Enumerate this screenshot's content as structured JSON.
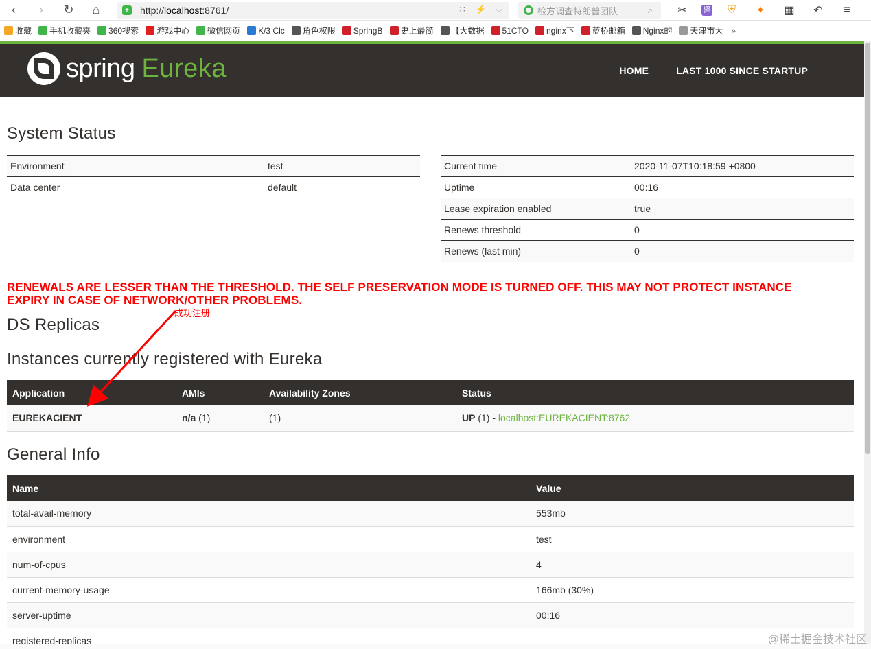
{
  "browser": {
    "url_prefix": "http://",
    "url_host": "localhost",
    "url_rest": ":8761/",
    "search_placeholder": "检方调查特朗普团队",
    "bookmarks": [
      {
        "label": "收藏",
        "color": "#f5a623"
      },
      {
        "label": "手机收藏夹",
        "color": "#3fb54a"
      },
      {
        "label": "360搜索",
        "color": "#3fb54a"
      },
      {
        "label": "游戏中心",
        "color": "#e02020"
      },
      {
        "label": "微信网页",
        "color": "#3fb54a"
      },
      {
        "label": "K/3 Clc",
        "color": "#2a7ad2"
      },
      {
        "label": "角色权限",
        "color": "#555555"
      },
      {
        "label": "SpringB",
        "color": "#d0202a"
      },
      {
        "label": "史上最简",
        "color": "#d0202a"
      },
      {
        "label": "【大数据",
        "color": "#555555"
      },
      {
        "label": "51CTO",
        "color": "#d0202a"
      },
      {
        "label": "nginx下",
        "color": "#d0202a"
      },
      {
        "label": "蓝桥邮箱",
        "color": "#d0202a"
      },
      {
        "label": "Nginx的",
        "color": "#555555"
      },
      {
        "label": "天津市大",
        "color": "#999999"
      }
    ],
    "bookmarks_more": "»"
  },
  "navbar": {
    "brand_spring": "spring",
    "brand_eureka": "Eureka",
    "home": "HOME",
    "last1000": "LAST 1000 SINCE STARTUP"
  },
  "system_status": {
    "title": "System Status",
    "left": [
      {
        "key": "Environment",
        "value": "test"
      },
      {
        "key": "Data center",
        "value": "default"
      }
    ],
    "right": [
      {
        "key": "Current time",
        "value": "2020-11-07T10:18:59 +0800"
      },
      {
        "key": "Uptime",
        "value": "00:16"
      },
      {
        "key": "Lease expiration enabled",
        "value": "true"
      },
      {
        "key": "Renews threshold",
        "value": "0"
      },
      {
        "key": "Renews (last min)",
        "value": "0"
      }
    ]
  },
  "warning_line1": "RENEWALS ARE LESSER THAN THE THRESHOLD. THE SELF PRESERVATION MODE IS TURNED OFF. THIS MAY NOT PROTECT INSTANCE",
  "warning_line2": "EXPIRY IN CASE OF NETWORK/OTHER PROBLEMS.",
  "ds_replicas_title": "DS Replicas",
  "annotation": "成功注册",
  "instances": {
    "title": "Instances currently registered with Eureka",
    "headers": [
      "Application",
      "AMIs",
      "Availability Zones",
      "Status"
    ],
    "rows": [
      {
        "app": "EUREKACIENT",
        "amis_bold": "n/a",
        "amis_rest": " (1)",
        "zones": "(1)",
        "status_bold": "UP",
        "status_rest": " (1) - ",
        "status_link": "localhost:EUREKACIENT:8762"
      }
    ]
  },
  "general_info": {
    "title": "General Info",
    "headers": [
      "Name",
      "Value"
    ],
    "rows": [
      {
        "name": "total-avail-memory",
        "value": "553mb"
      },
      {
        "name": "environment",
        "value": "test"
      },
      {
        "name": "num-of-cpus",
        "value": "4"
      },
      {
        "name": "current-memory-usage",
        "value": "166mb (30%)"
      },
      {
        "name": "server-uptime",
        "value": "00:16"
      },
      {
        "name": "registered-replicas",
        "value": ""
      }
    ]
  },
  "watermark": "@稀土掘金技术社区"
}
